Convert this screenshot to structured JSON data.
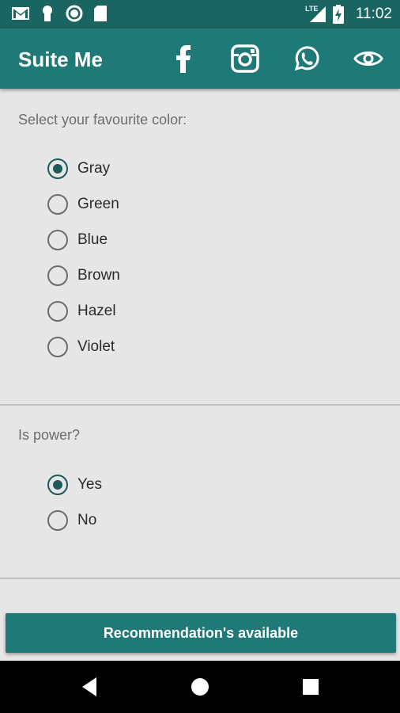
{
  "status_bar": {
    "time": "11:02",
    "network": "LTE",
    "icons": [
      "gmail-icon",
      "keyhole-icon",
      "sync-icon",
      "sdcard-icon",
      "lte-signal-icon",
      "battery-charging-icon"
    ]
  },
  "app_bar": {
    "title": "Suite Me",
    "actions": [
      "facebook-icon",
      "instagram-icon",
      "whatsapp-icon",
      "eye-icon"
    ]
  },
  "color_question": {
    "label": "Select your favourite color:",
    "options": [
      {
        "label": "Gray",
        "checked": true
      },
      {
        "label": "Green",
        "checked": false
      },
      {
        "label": "Blue",
        "checked": false
      },
      {
        "label": "Brown",
        "checked": false
      },
      {
        "label": "Hazel",
        "checked": false
      },
      {
        "label": "Violet",
        "checked": false
      }
    ]
  },
  "power_question": {
    "label": "Is power?",
    "options": [
      {
        "label": "Yes",
        "checked": true
      },
      {
        "label": "No",
        "checked": false
      }
    ]
  },
  "recommendation_button": {
    "label": "Recommendation's available"
  },
  "nav_bar": {
    "buttons": [
      "back-icon",
      "home-icon",
      "recents-icon"
    ]
  },
  "colors": {
    "app_bar": "#1f7a77",
    "status_bar": "#1a6462",
    "background": "#e6e6e6",
    "radio_checked": "#1b5b58"
  }
}
